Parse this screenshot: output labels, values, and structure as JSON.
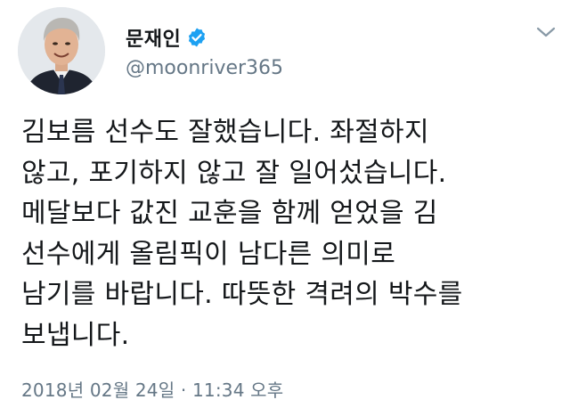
{
  "user": {
    "display_name": "문재인",
    "handle": "@moonriver365",
    "verified": true,
    "avatar_icon": "profile-photo"
  },
  "tweet": {
    "text": "김보름 선수도 잘했습니다. 좌절하지\n않고, 포기하지 않고 잘 일어섰습니다.\n메달보다 값진 교훈을 함께 얻었을 김\n선수에게 올림픽이 남다른 의미로\n남기를 바랍니다. 따뜻한 격려의 박수를\n보냅니다.",
    "timestamp": "2018년 02월 24일 · 11:34 오후"
  },
  "icons": {
    "verified": "verified-badge-icon",
    "menu": "chevron-down-icon"
  },
  "colors": {
    "verified_blue": "#1da1f2",
    "secondary_text": "#657786",
    "primary_text": "#14171a"
  }
}
